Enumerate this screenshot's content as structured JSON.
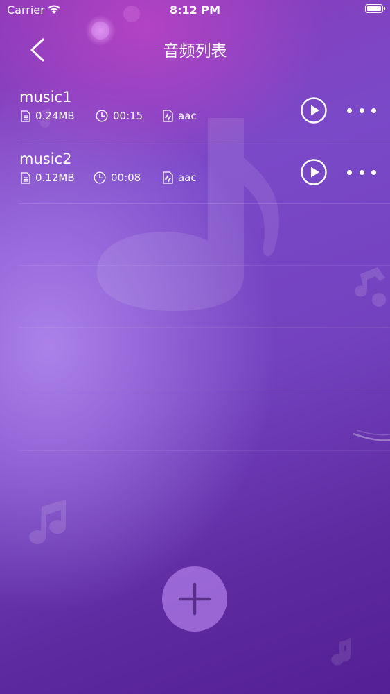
{
  "status_bar": {
    "carrier": "Carrier",
    "time": "8:12 PM"
  },
  "nav": {
    "title": "音频列表"
  },
  "tracks": [
    {
      "name": "music1",
      "size": "0.24MB",
      "duration": "00:15",
      "format": "aac"
    },
    {
      "name": "music2",
      "size": "0.12MB",
      "duration": "00:08",
      "format": "aac"
    }
  ],
  "icons": {
    "back": "chevron-left-icon",
    "size": "document-icon",
    "duration": "clock-icon",
    "format": "audio-file-icon",
    "play": "play-circle-icon",
    "more": "more-dots-icon",
    "add": "plus-icon"
  },
  "colors": {
    "background_top": "#8a3ab8",
    "background_bottom": "#531f93",
    "add_button": "#be8cf5"
  }
}
